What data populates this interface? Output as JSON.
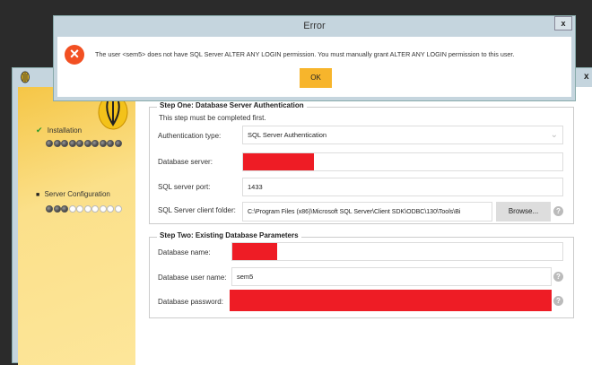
{
  "dialog": {
    "title": "Error",
    "close": "x",
    "message": "The user <sem5> does not have SQL Server ALTER ANY LOGIN permission. You must manually grant ALTER ANY LOGIN permission to this user.",
    "ok": "OK",
    "error_icon": "×"
  },
  "main": {
    "close": "x"
  },
  "sidebar": {
    "steps": [
      {
        "label": "Installation",
        "status": "done",
        "check": "✔",
        "progress": [
          1,
          1,
          1,
          1,
          1,
          1,
          1,
          1,
          1,
          1
        ]
      },
      {
        "label": "Server Configuration",
        "status": "current",
        "marker": "■",
        "progress": [
          1,
          1,
          1,
          0,
          0,
          0,
          0,
          0,
          0,
          0
        ]
      }
    ]
  },
  "step_one": {
    "title": "Step One: Database Server Authentication",
    "note": "This step must be completed first.",
    "auth_label": "Authentication type:",
    "auth_value": "SQL Server Authentication",
    "server_label": "Database server:",
    "port_label": "SQL server port:",
    "port_value": "1433",
    "folder_label": "SQL Server client folder:",
    "folder_value": "C:\\Program Files (x86)\\Microsoft SQL Server\\Client SDK\\ODBC\\130\\Tools\\Bi",
    "browse": "Browse...",
    "help": "?"
  },
  "step_two": {
    "title": "Step Two: Existing Database Parameters",
    "dbname_label": "Database name:",
    "user_label": "Database user name:",
    "user_value": "sem5",
    "password_label": "Database password:",
    "help": "?"
  }
}
